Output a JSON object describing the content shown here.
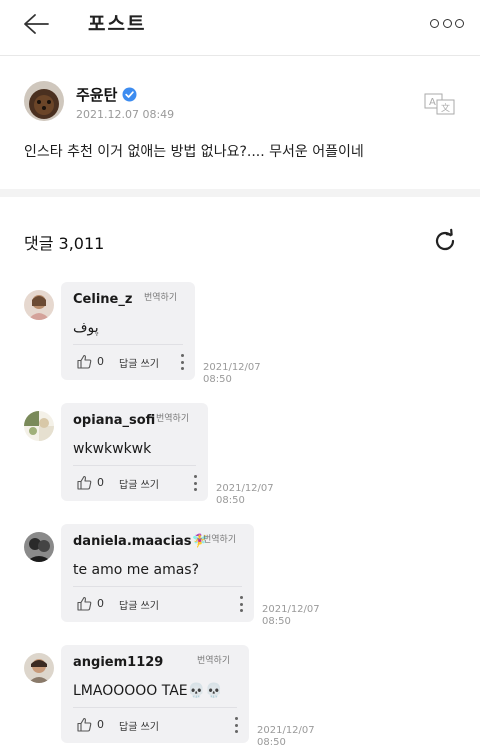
{
  "header": {
    "title": "포스트"
  },
  "post": {
    "author": "주윤탄",
    "timestamp": "2021.12.07 08:49",
    "text": "인스타 추천 이거 없애는 방법 없나요?.... 무서운 어플이네"
  },
  "comments_section": {
    "count_label": "댓글 3,011"
  },
  "comments": [
    {
      "user": "Celine_z",
      "translate": "번역하기",
      "text": "پوف",
      "likes": "0",
      "reply": "답글 쓰기",
      "date": "2021/12/07",
      "time": "08:50"
    },
    {
      "user": "opiana_sofi",
      "translate": "번역하기",
      "text": "wkwkwkwk",
      "likes": "0",
      "reply": "답글 쓰기",
      "date": "2021/12/07",
      "time": "08:50"
    },
    {
      "user": "daniela.maacias🧚‍♀️",
      "translate": "번역하기",
      "text": "te amo me amas?",
      "likes": "0",
      "reply": "답글 쓰기",
      "date": "2021/12/07",
      "time": "08:50"
    },
    {
      "user": "angiem1129",
      "translate": "번역하기",
      "text": "LMAOOOOO TAE💀💀",
      "likes": "0",
      "reply": "답글 쓰기",
      "date": "2021/12/07",
      "time": "08:50"
    }
  ],
  "icons": {
    "back": "arrow-left-icon",
    "more": "more-horizontal-icon",
    "verified": "verified-badge-icon",
    "translate": "translate-icon",
    "refresh": "refresh-icon",
    "like": "thumbs-up-icon",
    "menu": "kebab-menu-icon"
  },
  "colors": {
    "verified_blue": "#3d8cf0",
    "bubble_bg": "#f1f1f3",
    "muted_text": "#9a9a9a"
  }
}
